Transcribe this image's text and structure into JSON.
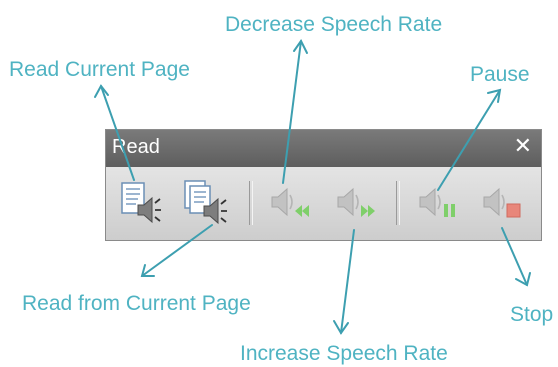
{
  "window": {
    "title": "Read",
    "close_glyph": "✕"
  },
  "toolbar": {
    "buttons": [
      {
        "id": "read-current-page",
        "icon": "read-page-icon",
        "enabled": true
      },
      {
        "id": "read-from-current-page",
        "icon": "read-from-page-icon",
        "enabled": true
      },
      {
        "id": "decrease-speech-rate",
        "icon": "speaker-rewind-icon",
        "enabled": false
      },
      {
        "id": "increase-speech-rate",
        "icon": "speaker-forward-icon",
        "enabled": false
      },
      {
        "id": "pause",
        "icon": "speaker-pause-icon",
        "enabled": false
      },
      {
        "id": "stop",
        "icon": "speaker-stop-icon",
        "enabled": false
      }
    ]
  },
  "callouts": {
    "read_current_page": "Read Current Page",
    "decrease_speech_rate": "Decrease Speech Rate",
    "pause": "Pause",
    "read_from_current_page": "Read from Current Page",
    "increase_speech_rate": "Increase Speech Rate",
    "stop": "Stop"
  },
  "colors": {
    "callout_text": "#4fb3c2",
    "arrow": "#3d9fb0",
    "titlebar": "#6b6b6b",
    "toolbar_bg": "#d3d3d3",
    "green_accent": "#6cc04a",
    "red_accent": "#e06a5a"
  }
}
